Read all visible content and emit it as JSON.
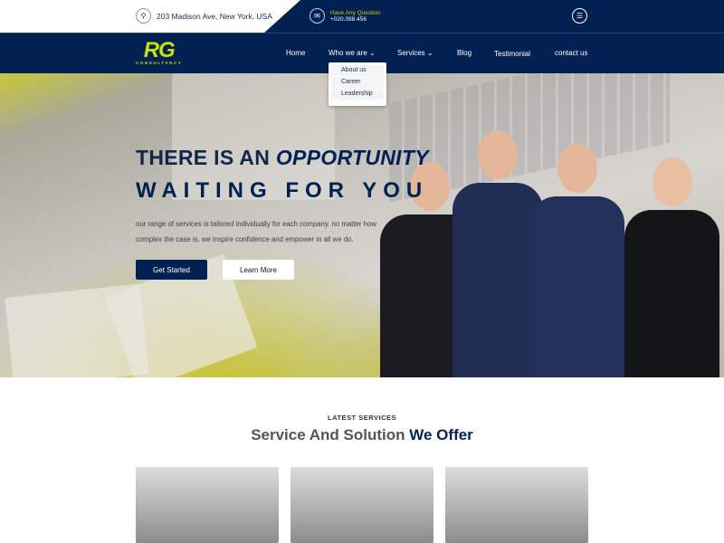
{
  "topbar": {
    "address": "203 Madison Ave, New York, USA",
    "question_label": "Have Any Question",
    "phone": "+020.098.456"
  },
  "logo": {
    "main": "RG",
    "sub": "CONSULTANCY"
  },
  "nav": {
    "items": [
      "Home",
      "Who we are ⌄",
      "Services ⌄",
      "Blog",
      "Testimonial",
      "contact us"
    ],
    "dropdown": [
      "About us",
      "Career",
      "Leadership"
    ]
  },
  "hero": {
    "line1a": "THERE IS AN ",
    "line1b": "OPPORTUNITY",
    "line2": "WAITING FOR YOU",
    "description": "our range of services is tailored individually for each company. no matter how complex the case is, we inspire confidence and empower in all we do.",
    "primary_button": "Get Started",
    "secondary_button": "Learn More"
  },
  "services": {
    "subtitle": "LATEST SERVICES",
    "title_a": "Service And Solution ",
    "title_b": "We Offer"
  },
  "colors": {
    "navy": "#002152",
    "accent": "#c9e200"
  }
}
